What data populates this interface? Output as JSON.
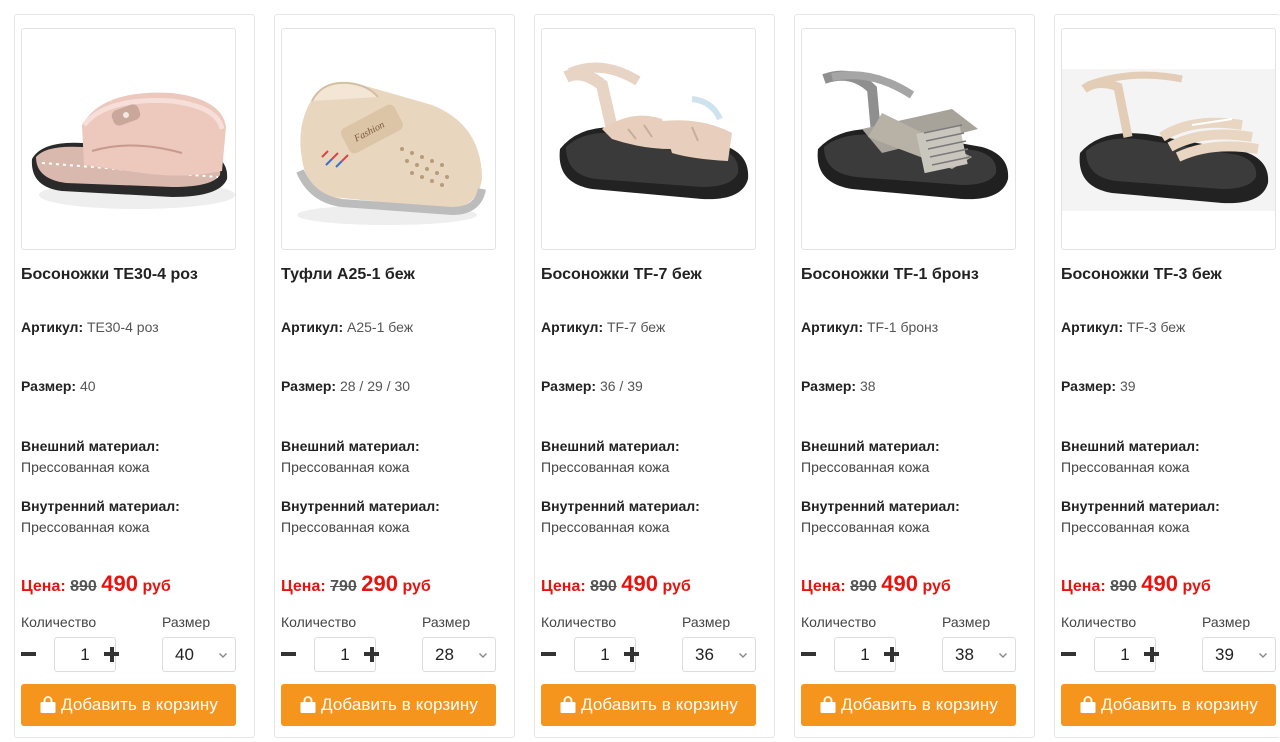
{
  "labels": {
    "article": "Артикул:",
    "size": "Размер:",
    "outer_material": "Внешний материал:",
    "inner_material": "Внутренний материал:",
    "price": "Цена:",
    "currency": "руб",
    "quantity": "Количество",
    "size_select": "Размер",
    "add_to_cart": "Добавить в корзину"
  },
  "colors": {
    "accent": "#f6951e",
    "price_red": "#e8130f"
  },
  "products": [
    {
      "title": "Босоножки TE30-4 роз",
      "article": "TE30-4 роз",
      "sizes": "40",
      "outer_material": "Прессованная кожа",
      "inner_material": "Прессованная кожа",
      "old_price": "890",
      "new_price": "490",
      "quantity": "1",
      "selected_size": "40",
      "image": "pink-slide-sandal"
    },
    {
      "title": "Туфли A25-1 беж",
      "article": "A25-1 беж",
      "sizes": "28 / 29 / 30",
      "outer_material": "Прессованная кожа",
      "inner_material": "Прессованная кожа",
      "old_price": "790",
      "new_price": "290",
      "quantity": "1",
      "selected_size": "28",
      "image": "beige-perforated-shoe"
    },
    {
      "title": "Босоножки TF-7 беж",
      "article": "TF-7 беж",
      "sizes": "36 / 39",
      "outer_material": "Прессованная кожа",
      "inner_material": "Прессованная кожа",
      "old_price": "890",
      "new_price": "490",
      "quantity": "1",
      "selected_size": "36",
      "image": "beige-strap-sandal"
    },
    {
      "title": "Босоножки TF-1 бронз",
      "article": "TF-1 бронз",
      "sizes": "38",
      "outer_material": "Прессованная кожа",
      "inner_material": "Прессованная кожа",
      "old_price": "890",
      "new_price": "490",
      "quantity": "1",
      "selected_size": "38",
      "image": "bronze-cross-sandal"
    },
    {
      "title": "Босоножки TF-3 беж",
      "article": "TF-3 беж",
      "sizes": "39",
      "outer_material": "Прессованная кожа",
      "inner_material": "Прессованная кожа",
      "old_price": "890",
      "new_price": "490",
      "quantity": "1",
      "selected_size": "39",
      "image": "beige-multi-strap-sandal"
    }
  ]
}
